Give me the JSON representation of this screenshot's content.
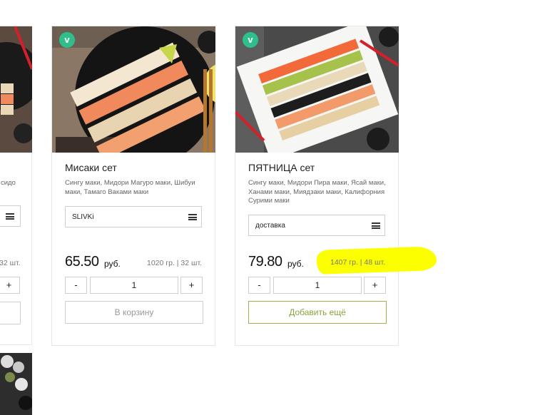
{
  "cards": [
    {
      "title": "",
      "description_tail": "сидо",
      "price": "",
      "currency": "",
      "weight_tail": "32 шт.",
      "quantity_plus": "+"
    },
    {
      "badge": "v",
      "title": "Мисаки сет",
      "description": "Сингу маки, Мидори Магуро маки, Шибуи маки, Тамаго Ваками маки",
      "option": "SLIVKi",
      "price": "65.50",
      "currency": "руб.",
      "weight": "1020 гр. | 32 шт.",
      "quantity": "1",
      "quantity_minus": "-",
      "quantity_plus": "+",
      "cta": "В корзину"
    },
    {
      "badge": "v",
      "title": "ПЯТНИЦА сет",
      "description": "Сингу маки, Мидори Пира маки, Ясай маки, Ханами маки, Миядзаки маки, Калифорния Сурими маки",
      "option": "доставка",
      "price": "79.80",
      "currency": "руб.",
      "weight": "1407 гр. | 48 шт.",
      "quantity": "1",
      "quantity_minus": "-",
      "quantity_plus": "+",
      "cta": "Добавить ещё"
    }
  ],
  "colors": {
    "badge": "#2fbf8c",
    "highlight": "#fbff00",
    "cta_active": "#8aa23c"
  }
}
